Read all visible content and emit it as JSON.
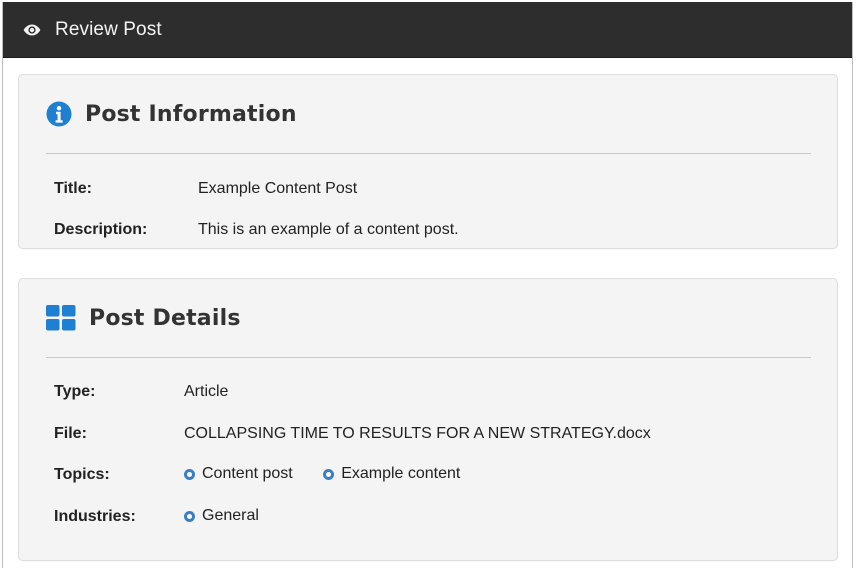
{
  "window": {
    "title": "Review Post",
    "icon": "eye-icon"
  },
  "post_information": {
    "heading": "Post Information",
    "icon": "info-icon",
    "fields": {
      "title_label": "Title:",
      "title_value": "Example Content Post",
      "description_label": "Description:",
      "description_value": "This is an example of a content post."
    }
  },
  "post_details": {
    "heading": "Post Details",
    "icon": "grid-icon",
    "fields": {
      "type_label": "Type:",
      "type_value": "Article",
      "file_label": "File:",
      "file_value": "COLLAPSING TIME TO RESULTS FOR A NEW STRATEGY.docx",
      "topics_label": "Topics:",
      "topics": [
        "Content post",
        "Example content"
      ],
      "industries_label": "Industries:",
      "industries": [
        "General"
      ]
    }
  },
  "colors": {
    "titlebar_bg": "#2d2d2d",
    "accent": "#1f7fd1",
    "panel_bg": "#f4f4f4"
  }
}
